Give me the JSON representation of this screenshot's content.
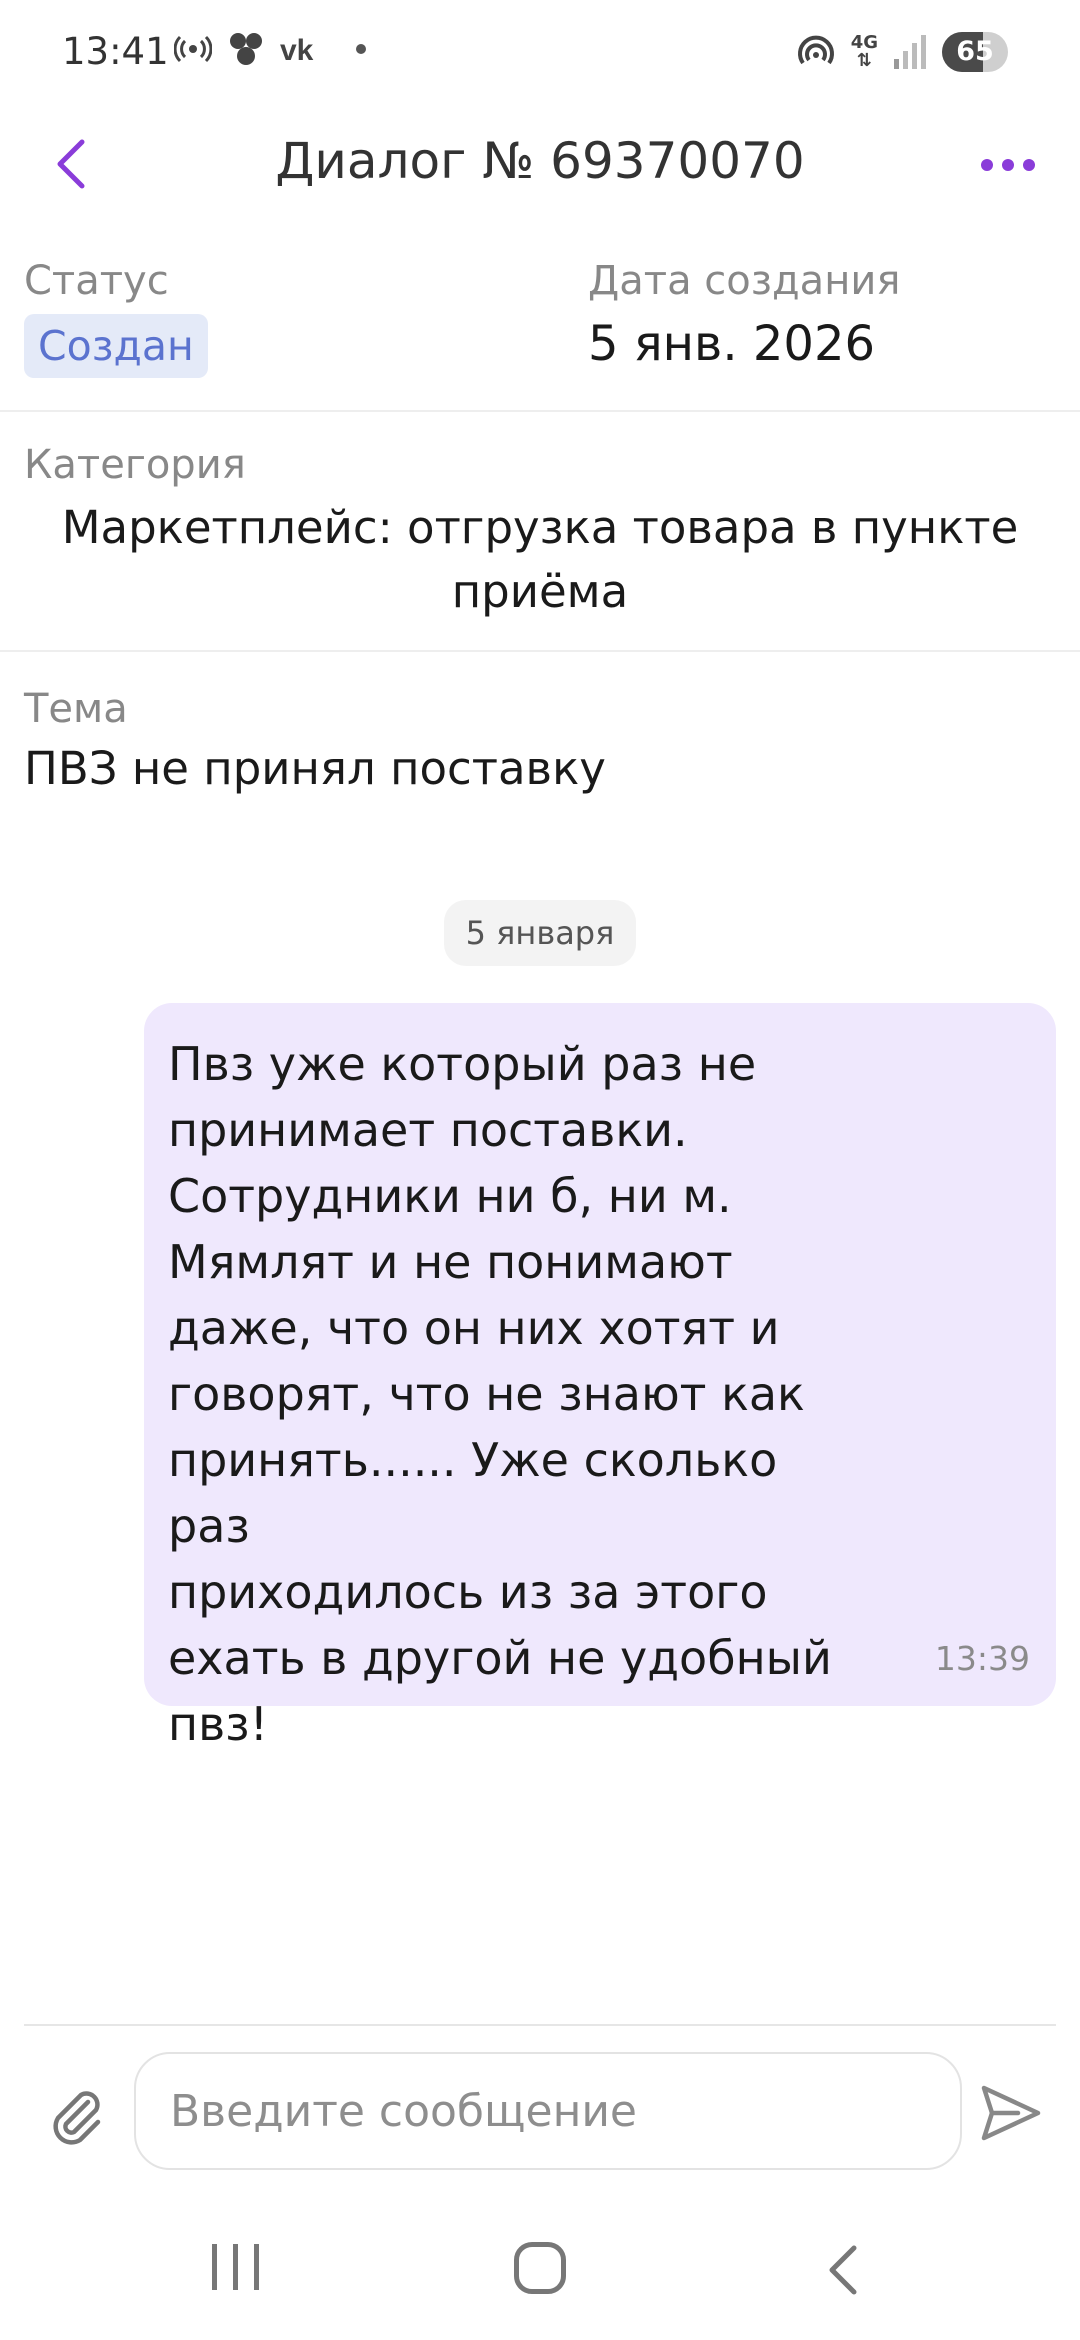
{
  "status_bar": {
    "time": "13:41",
    "icons": [
      "hotspot-icon",
      "cluster-icon",
      "vk-icon",
      "notification-dot"
    ],
    "network": "4G",
    "battery": "65"
  },
  "header": {
    "title": "Диалог № 69370070",
    "back_icon": "chevron-left-icon",
    "more_icon": "more-dots-icon",
    "accent_color": "#8a3cd9"
  },
  "info": {
    "status_label": "Статус",
    "status_value": "Создан",
    "date_label": "Дата создания",
    "date_value": "5 янв. 2026",
    "category_label": "Категория",
    "category_value": "Маркетплейс: отгрузка товара в пункте приёма",
    "topic_label": "Тема",
    "topic_value": "ПВЗ не принял поставку"
  },
  "chat": {
    "date_chip": "5 января",
    "messages": [
      {
        "text": "Пвз уже который раз не\nпринимает поставки.\nСотрудники ни б, ни м.\nМямлят и не понимают\nдаже, что он них хотят и\nговорят, что не знают как\nпринять...... Уже сколько раз\nприходилось из за этого\nехать в другой не удобный\nпвз!",
        "time": "13:39",
        "bubble_color": "#efe8fd"
      }
    ]
  },
  "composer": {
    "placeholder": "Введите сообщение",
    "attach_icon": "paperclip-icon",
    "send_icon": "send-icon"
  },
  "nav_bar": {
    "buttons": [
      "recent-apps-icon",
      "home-icon",
      "back-icon"
    ]
  }
}
